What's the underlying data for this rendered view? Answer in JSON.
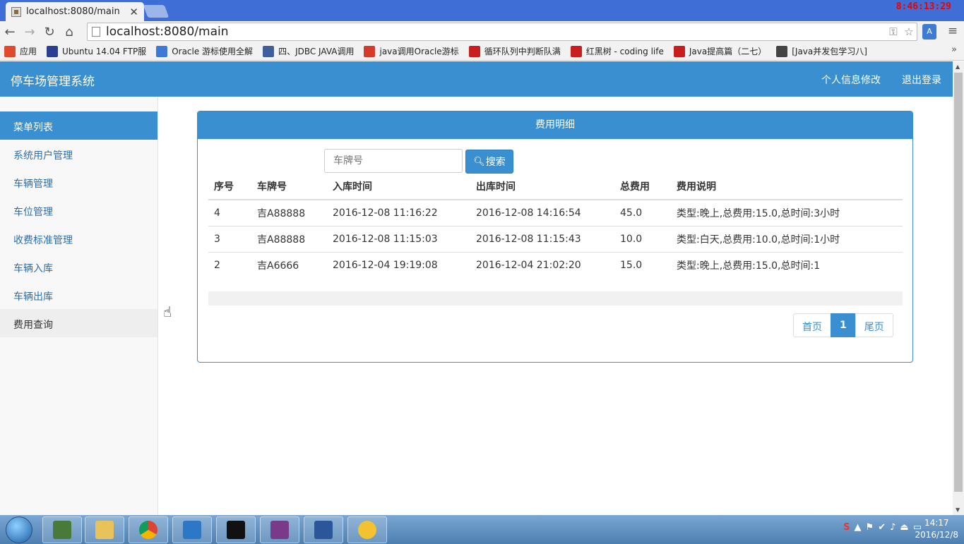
{
  "browser": {
    "tab_title": "localhost:8080/main",
    "url": "localhost:8080/main",
    "overlay_time": "8:46:13:29",
    "bookmarks": [
      {
        "label": "应用",
        "color": "#e04b2b"
      },
      {
        "label": "Ubuntu 14.04 FTP服",
        "color": "#2a3f8f"
      },
      {
        "label": "Oracle 游标使用全解",
        "color": "#3e79d6"
      },
      {
        "label": "四、JDBC JAVA调用",
        "color": "#3d5f9e"
      },
      {
        "label": "java调用Oracle游标",
        "color": "#d43b2b"
      },
      {
        "label": "循环队列中判断队满",
        "color": "#c81e1e"
      },
      {
        "label": "红黑树 - coding life",
        "color": "#c81e1e"
      },
      {
        "label": "Java提高篇（二七）",
        "color": "#c81e1e"
      },
      {
        "label": "[Java并发包学习八]",
        "color": "#444444"
      }
    ]
  },
  "app": {
    "brand": "停车场管理系统",
    "header_links": [
      "个人信息修改",
      "退出登录"
    ]
  },
  "sidebar": {
    "heading": "菜单列表",
    "items": [
      "系统用户管理",
      "车辆管理",
      "车位管理",
      "收费标准管理",
      "车辆入库",
      "车辆出库",
      "费用查询"
    ],
    "active_index": 6
  },
  "panel": {
    "title": "费用明细",
    "search_placeholder": "车牌号",
    "search_label": "搜索",
    "columns": [
      "序号",
      "车牌号",
      "入库时间",
      "出库时间",
      "总费用",
      "费用说明"
    ],
    "rows": [
      [
        "4",
        "吉A88888",
        "2016-12-08 11:16:22",
        "2016-12-08 14:16:54",
        "45.0",
        "类型:晚上,总费用:15.0,总时间:3小时"
      ],
      [
        "3",
        "吉A88888",
        "2016-12-08 11:15:03",
        "2016-12-08 11:15:43",
        "10.0",
        "类型:白天,总费用:10.0,总时间:1小时"
      ],
      [
        "2",
        "吉A6666",
        "2016-12-04 19:19:08",
        "2016-12-04 21:02:20",
        "15.0",
        "类型:晚上,总费用:15.0,总时间:1"
      ]
    ],
    "pager": {
      "first": "首页",
      "current": "1",
      "last": "尾页"
    }
  },
  "taskbar": {
    "time": "14:17",
    "date": "2016/12/8"
  },
  "colors": {
    "primary": "#3a8fd0"
  }
}
